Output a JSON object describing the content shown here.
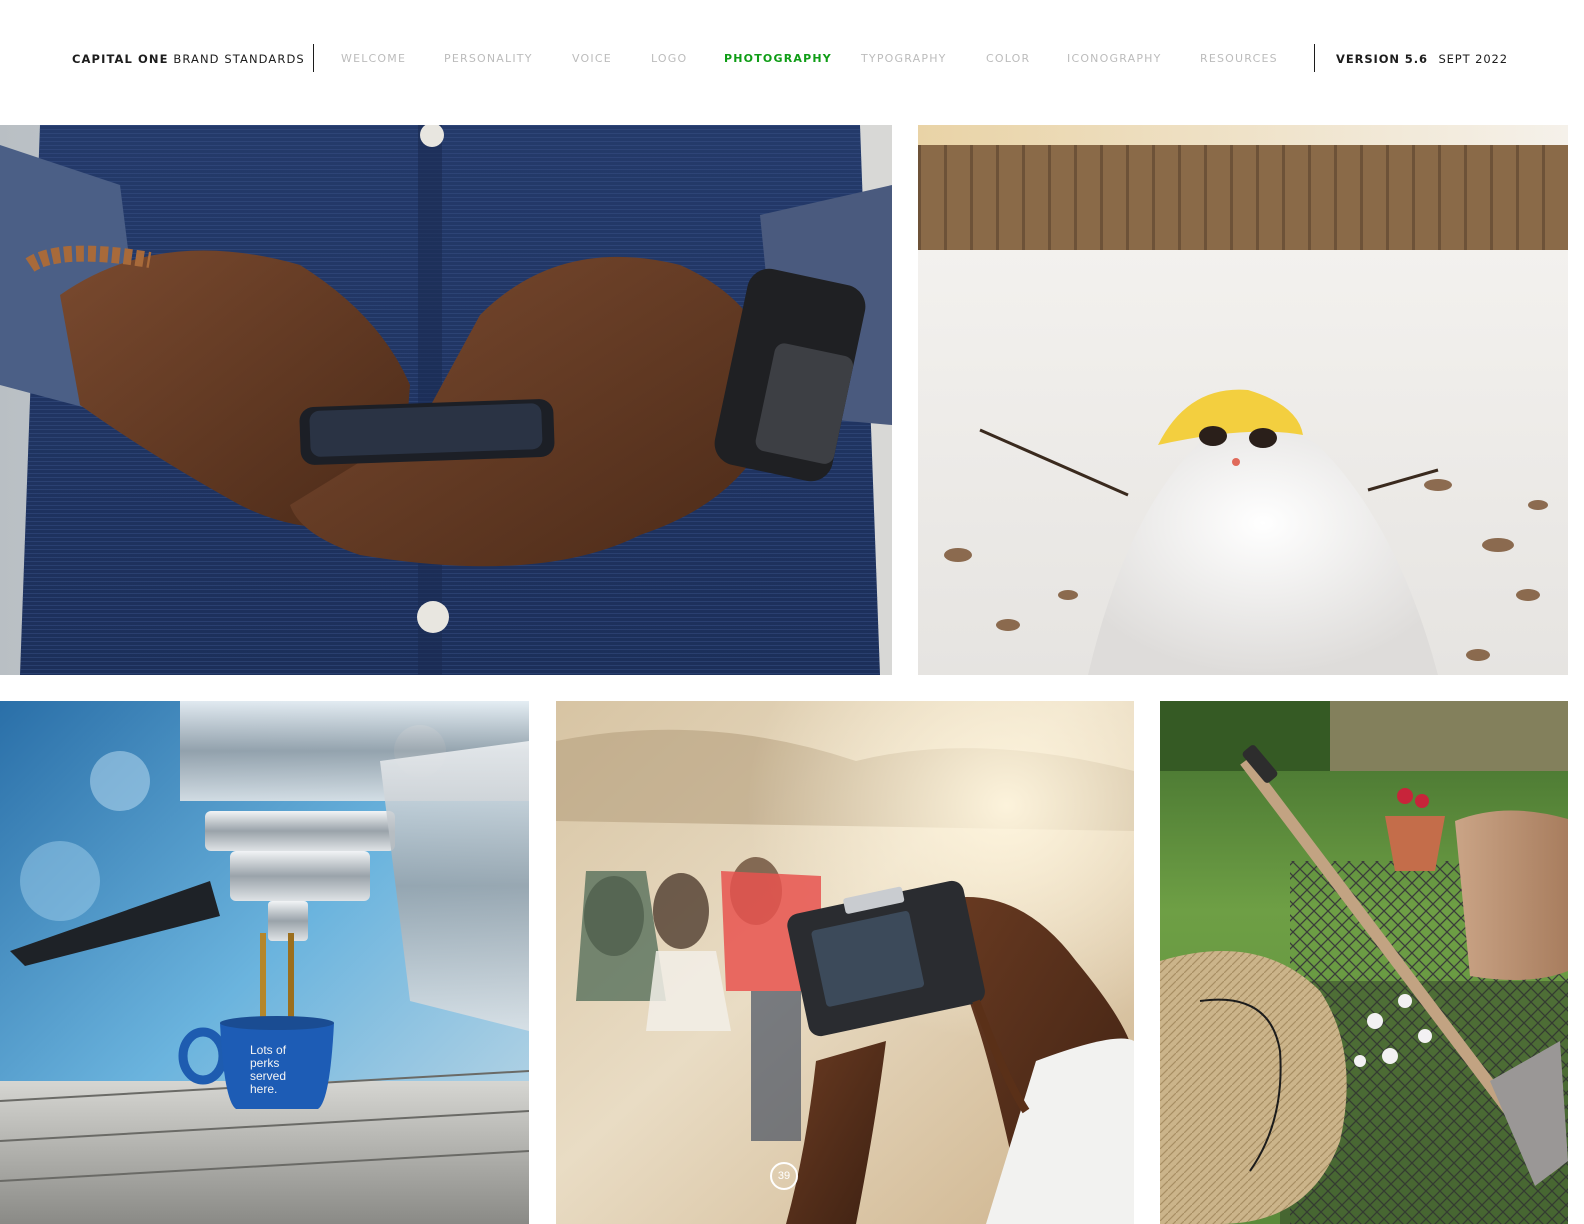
{
  "header": {
    "brand_bold": "CAPITAL ONE",
    "brand_rest": "BRAND STANDARDS",
    "nav": [
      {
        "label": "WELCOME",
        "active": false
      },
      {
        "label": "PERSONALITY",
        "active": false
      },
      {
        "label": "VOICE",
        "active": false
      },
      {
        "label": "LOGO",
        "active": false
      },
      {
        "label": "PHOTOGRAPHY",
        "active": true
      },
      {
        "label": "TYPOGRAPHY",
        "active": false
      },
      {
        "label": "COLOR",
        "active": false
      },
      {
        "label": "ICONOGRAPHY",
        "active": false
      },
      {
        "label": "RESOURCES",
        "active": false
      }
    ],
    "version_label": "VERSION 5.6",
    "version_date": "SEPT 2022"
  },
  "photos": {
    "espresso_cup_text": [
      "Lots of",
      "perks",
      "served",
      "here."
    ]
  },
  "page_number": "39",
  "colors": {
    "active_nav": "#0f9d16",
    "inactive_nav": "#bcbcbc",
    "text": "#1c1c1c"
  }
}
